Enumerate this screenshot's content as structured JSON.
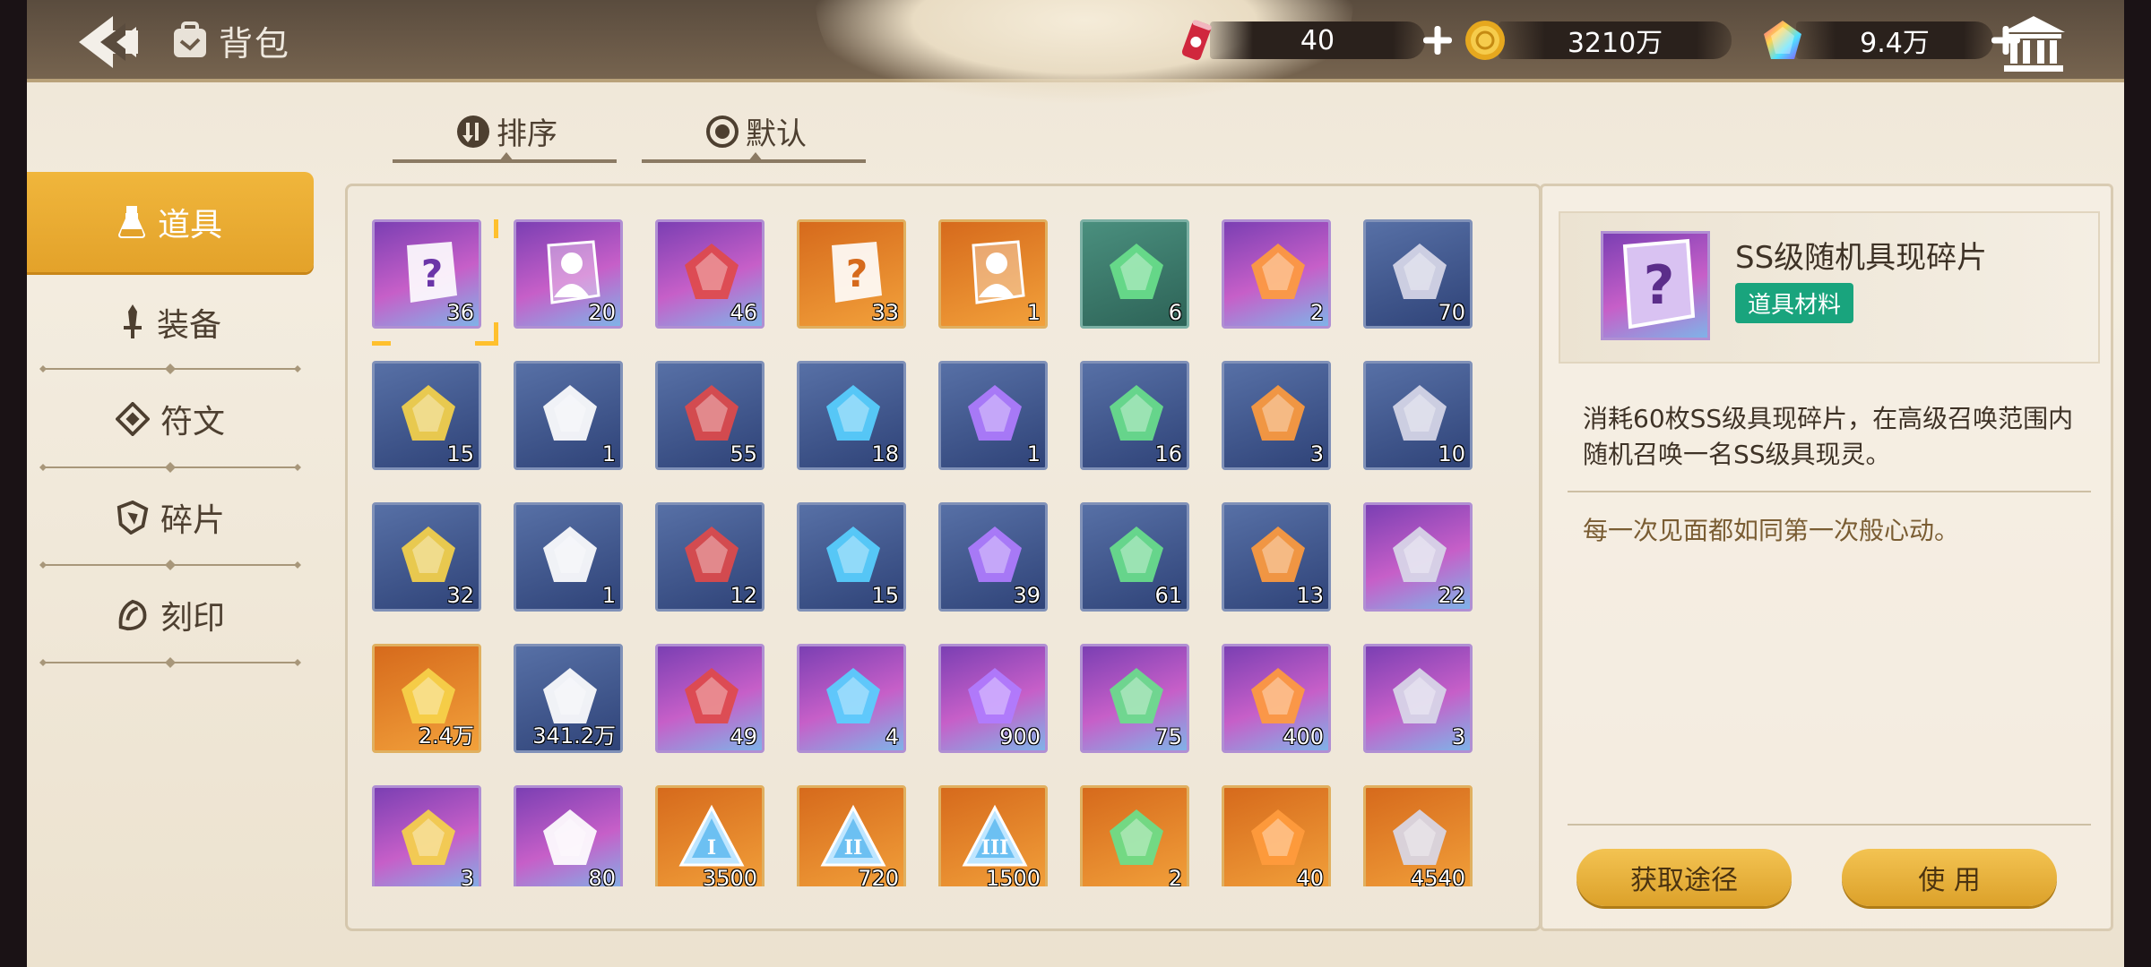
{
  "header": {
    "title": "背包",
    "resources": [
      {
        "icon": "energy-can-icon",
        "value": "40"
      },
      {
        "icon": "gold-coin-icon",
        "value": "3210万"
      },
      {
        "icon": "rainbow-gem-icon",
        "value": "9.4万"
      }
    ]
  },
  "sortbar": {
    "sort_label": "排序",
    "default_label": "默认"
  },
  "tabs": [
    {
      "label": "道具",
      "icon": "potion-icon",
      "active": true
    },
    {
      "label": "装备",
      "icon": "sword-icon",
      "active": false
    },
    {
      "label": "符文",
      "icon": "rune-icon",
      "active": false
    },
    {
      "label": "碎片",
      "icon": "shard-icon",
      "active": false
    },
    {
      "label": "刻印",
      "icon": "seal-icon",
      "active": false
    }
  ],
  "items": [
    {
      "name": "ss-random-fragment",
      "qty": "36",
      "rarity": "purple"
    },
    {
      "name": "ss-silhouette-fragment",
      "qty": "20",
      "rarity": "purple"
    },
    {
      "name": "red-potion",
      "qty": "46",
      "rarity": "purple"
    },
    {
      "name": "s-random-fragment",
      "qty": "33",
      "rarity": "orange"
    },
    {
      "name": "s-silhouette-fragment",
      "qty": "1",
      "rarity": "orange"
    },
    {
      "name": "crystal-crown",
      "qty": "6",
      "rarity": "teal"
    },
    {
      "name": "robot-pet",
      "qty": "2",
      "rarity": "purple"
    },
    {
      "name": "green-crystal",
      "qty": "70",
      "rarity": "blue"
    },
    {
      "name": "gray-stone",
      "qty": "15",
      "rarity": "blue"
    },
    {
      "name": "leaf-branch",
      "qty": "1",
      "rarity": "blue"
    },
    {
      "name": "purple-ore",
      "qty": "55",
      "rarity": "blue"
    },
    {
      "name": "water-bowl",
      "qty": "18",
      "rarity": "blue"
    },
    {
      "name": "orange-teapot",
      "qty": "1",
      "rarity": "blue"
    },
    {
      "name": "pink-teapot",
      "qty": "16",
      "rarity": "blue"
    },
    {
      "name": "red-jar",
      "qty": "3",
      "rarity": "blue"
    },
    {
      "name": "grain-pile",
      "qty": "10",
      "rarity": "blue"
    },
    {
      "name": "potatoes",
      "qty": "32",
      "rarity": "blue"
    },
    {
      "name": "golden-apple",
      "qty": "1",
      "rarity": "blue"
    },
    {
      "name": "umbrella",
      "qty": "12",
      "rarity": "blue"
    },
    {
      "name": "open-book",
      "qty": "15",
      "rarity": "blue"
    },
    {
      "name": "tome",
      "qty": "39",
      "rarity": "blue"
    },
    {
      "name": "milk-carton",
      "qty": "61",
      "rarity": "blue"
    },
    {
      "name": "medal",
      "qty": "13",
      "rarity": "blue"
    },
    {
      "name": "blue-gem",
      "qty": "22",
      "rarity": "purple"
    },
    {
      "name": "purple-crystal",
      "qty": "2.4万",
      "rarity": "orange"
    },
    {
      "name": "white-crystal",
      "qty": "341.2万",
      "rarity": "blue"
    },
    {
      "name": "dagger",
      "qty": "49",
      "rarity": "purple"
    },
    {
      "name": "red-star-shard",
      "qty": "4",
      "rarity": "purple"
    },
    {
      "name": "data-cube",
      "qty": "900",
      "rarity": "purple"
    },
    {
      "name": "ice-cube",
      "qty": "75",
      "rarity": "purple"
    },
    {
      "name": "purple-dice",
      "qty": "400",
      "rarity": "purple"
    },
    {
      "name": "fashion-card",
      "qty": "3",
      "rarity": "purple"
    },
    {
      "name": "color-orb",
      "qty": "3",
      "rarity": "purple"
    },
    {
      "name": "prism-gem",
      "qty": "80",
      "rarity": "purple"
    },
    {
      "name": "triangle-crystal-1",
      "qty": "3500",
      "rarity": "orange",
      "numeral": "I"
    },
    {
      "name": "triangle-crystal-2",
      "qty": "720",
      "rarity": "orange",
      "numeral": "II"
    },
    {
      "name": "triangle-crystal-3",
      "qty": "1500",
      "rarity": "orange",
      "numeral": "III"
    },
    {
      "name": "dynamite",
      "qty": "2",
      "rarity": "orange"
    },
    {
      "name": "red-crystal",
      "qty": "40",
      "rarity": "orange"
    },
    {
      "name": "gold-badge",
      "qty": "4540",
      "rarity": "orange"
    }
  ],
  "detail": {
    "name": "SS级随机具现碎片",
    "tag": "道具材料",
    "description": "消耗60枚SS级具现碎片，在高级召唤范围内随机召唤一名SS级具现灵。",
    "flavor": "每一次见面都如同第一次般心动。",
    "acquire_label": "获取途径",
    "use_label": "使 用"
  },
  "colors": {
    "accent": "#e8a82e",
    "tag_green": "#19a47d",
    "text_dark": "#3e3226",
    "flavor": "#7a5d33"
  }
}
